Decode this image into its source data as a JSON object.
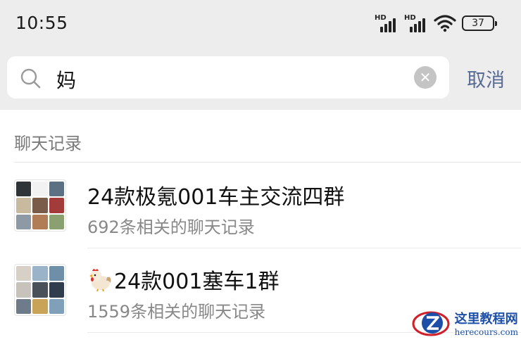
{
  "status_bar": {
    "time": "10:55",
    "signal_1_label": "HD",
    "signal_2_label": "HD",
    "battery_level": "37"
  },
  "search": {
    "query": "妈",
    "clear_icon": "clear-icon",
    "cancel_label": "取消"
  },
  "results": {
    "section_title": "聊天记录",
    "items": [
      {
        "title": "24款极氪001车主交流四群",
        "subtitle": "692条相关的聊天记录",
        "avatar_colors": [
          "#2f3438",
          "#f2f2f2",
          "#5c7084",
          "#c9b99f",
          "#7a5c4a",
          "#a33b3b",
          "#8d9aa5",
          "#b07d57",
          "#8aa070"
        ]
      },
      {
        "title_emoji": "chicken-emoji",
        "title": "24款001塞车1群",
        "subtitle": "1559条相关的聊天记录",
        "avatar_colors": [
          "#d6d0c6",
          "#9bb3c9",
          "#6f8fa8",
          "#c7c2bb",
          "#4b5158",
          "#2f3d4d",
          "#6d7b8a",
          "#c9a458",
          "#7fa0b8"
        ]
      }
    ]
  },
  "watermark": {
    "text_cn": "这里教程网",
    "text_en": "herecours.com"
  }
}
